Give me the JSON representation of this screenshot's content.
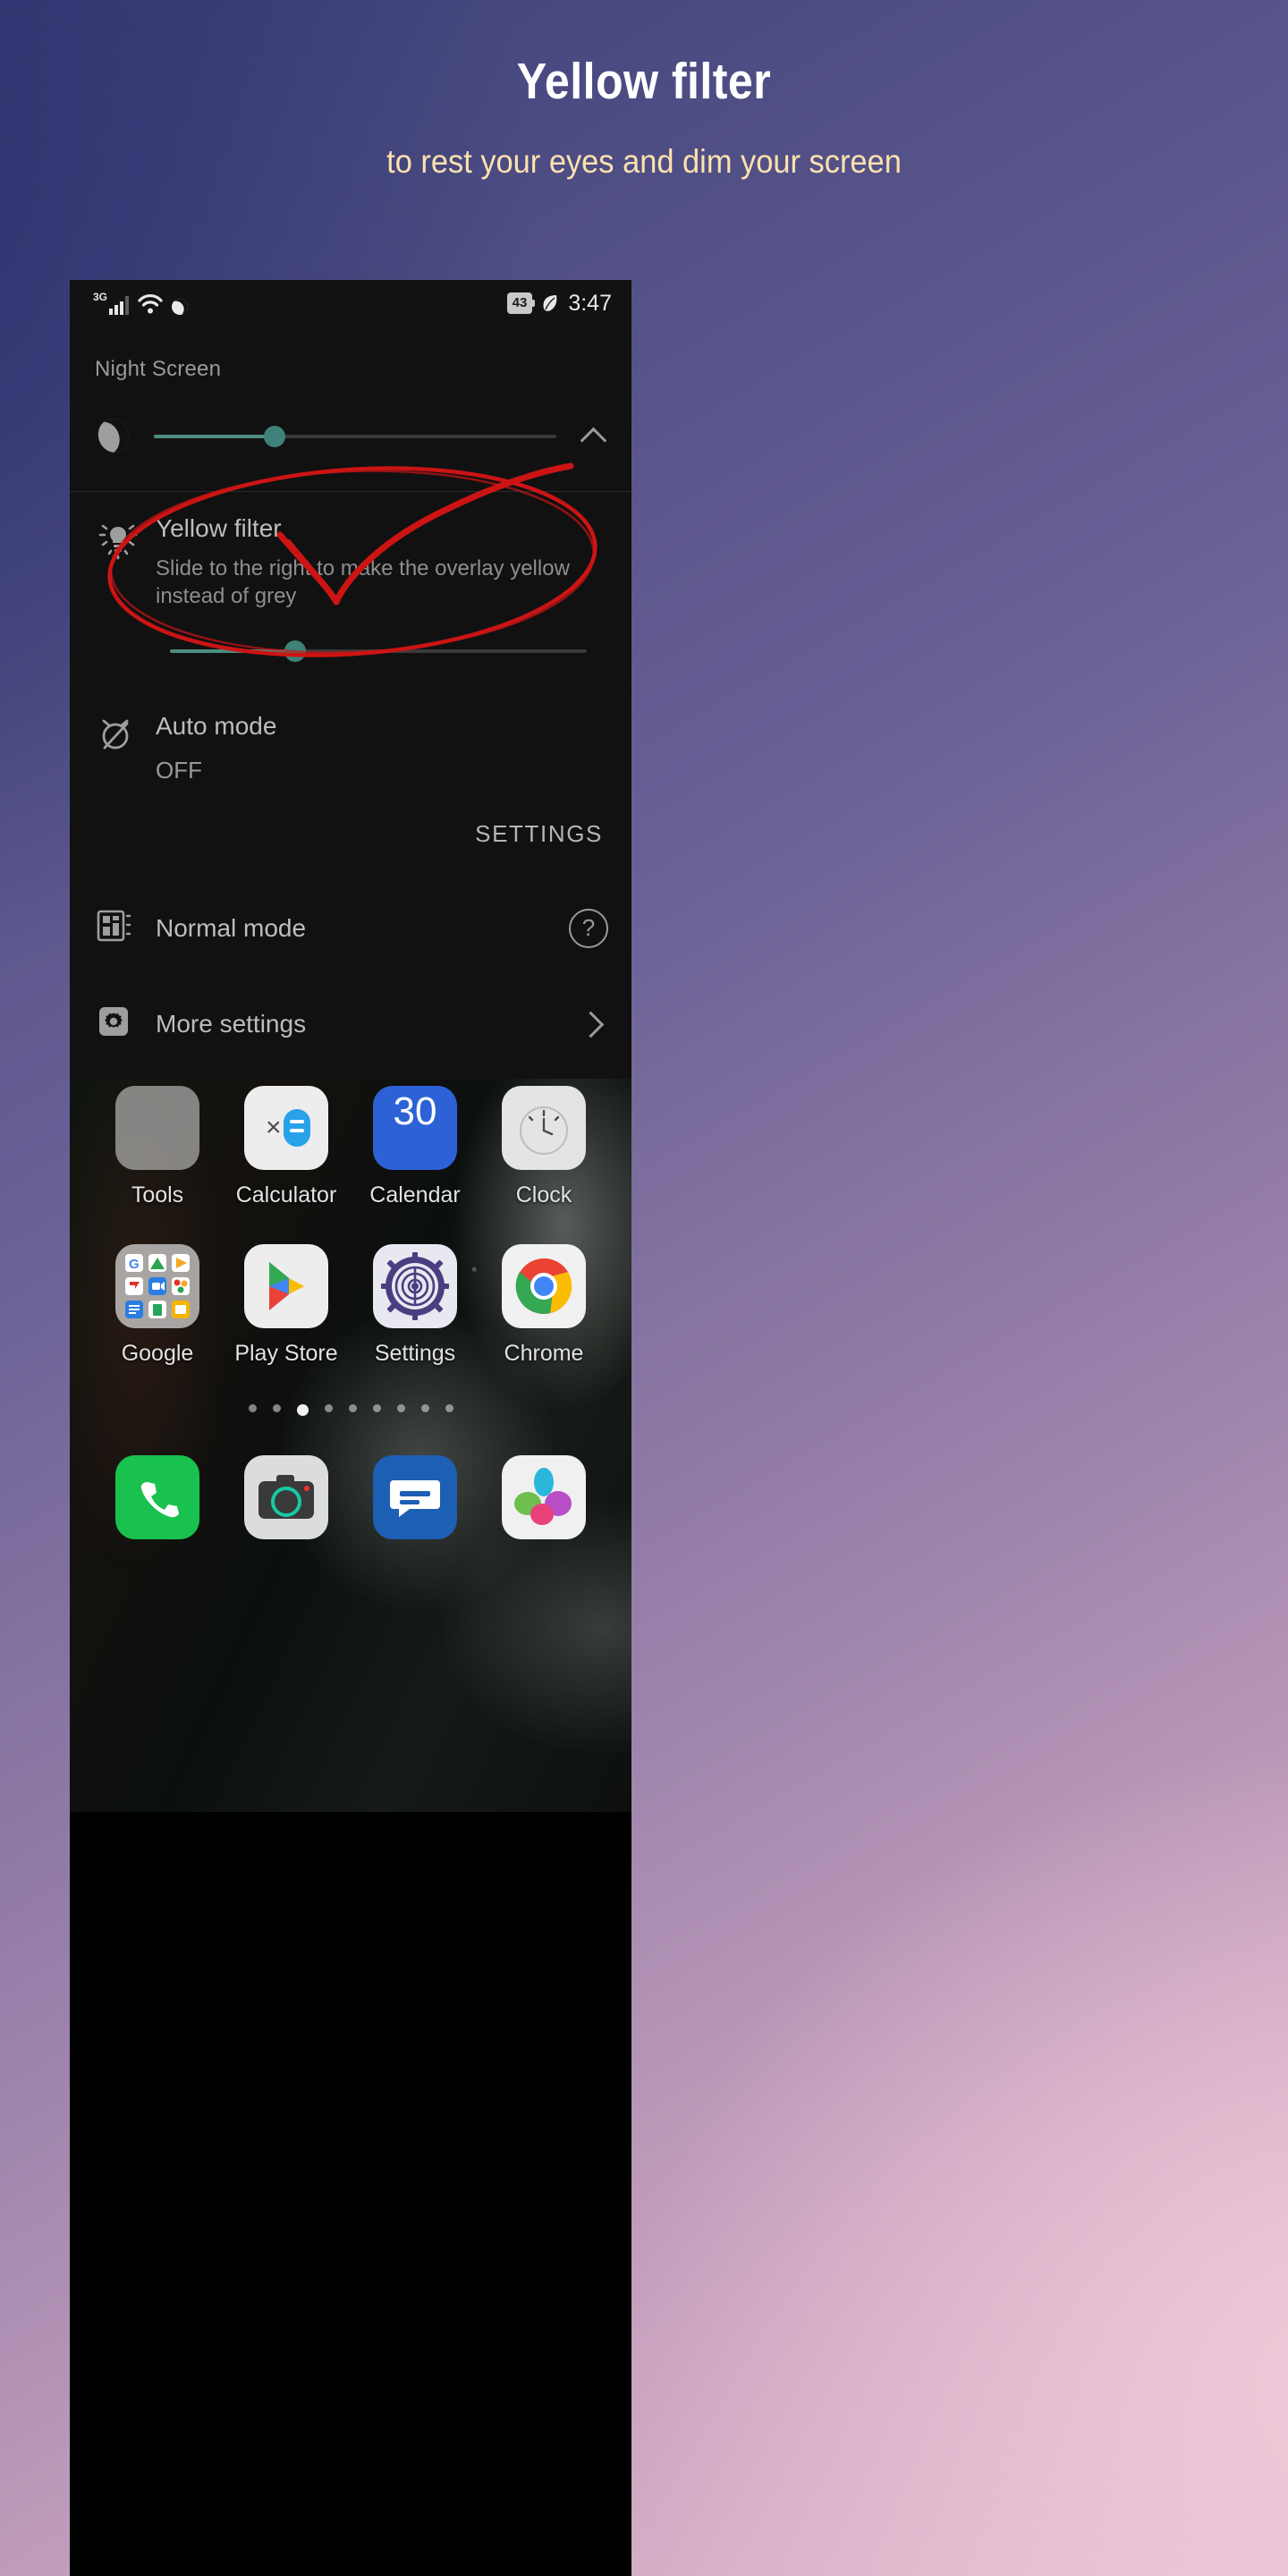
{
  "header": {
    "title": "Yellow filter",
    "subtitle": "to rest your eyes and dim your screen",
    "title_color": "#ffffff",
    "subtitle_color": "#fce1ae"
  },
  "statusbar": {
    "network_type": "3G",
    "signal_icon": "signal-bars-icon",
    "wifi_icon": "wifi-icon",
    "dnd_icon": "moon-icon",
    "battery_level": "43",
    "battery_icon": "battery-icon",
    "stamina_icon": "leaf-icon",
    "time": "3:47"
  },
  "panel": {
    "title": "Night Screen",
    "brightness": {
      "icon": "moon-icon",
      "value_percent": 30,
      "collapse_icon": "chevron-up-icon"
    },
    "yellow_filter": {
      "icon": "lightbulb-icon",
      "title": "Yellow filter",
      "description": "Slide to the right to make the overlay yellow instead of grey",
      "value_percent": 30
    },
    "auto_mode": {
      "icon": "alarm-off-icon",
      "title": "Auto mode",
      "value": "OFF"
    },
    "settings_button": "SETTINGS",
    "normal_mode": {
      "icon": "layout-mode-icon",
      "label": "Normal mode",
      "help_icon": "question-circle-icon"
    },
    "more_settings": {
      "icon": "gear-icon",
      "label": "More settings",
      "chevron_icon": "chevron-right-icon"
    },
    "accent_color": "#3f8279",
    "background_color": "#111111"
  },
  "home": {
    "row1": [
      {
        "name": "Tools",
        "icon": "folder-tools-icon"
      },
      {
        "name": "Calculator",
        "icon": "calculator-icon"
      },
      {
        "name": "Calendar",
        "icon": "calendar-icon",
        "badge": "30"
      },
      {
        "name": "Clock",
        "icon": "clock-icon"
      }
    ],
    "row2": [
      {
        "name": "Google",
        "icon": "google-folder-icon"
      },
      {
        "name": "Play Store",
        "icon": "play-store-icon"
      },
      {
        "name": "Settings",
        "icon": "settings-gear-icon"
      },
      {
        "name": "Chrome",
        "icon": "chrome-icon"
      }
    ],
    "dock": [
      {
        "name": "Phone",
        "icon": "phone-icon"
      },
      {
        "name": "Camera",
        "icon": "camera-icon"
      },
      {
        "name": "Messages",
        "icon": "messages-icon"
      },
      {
        "name": "Album",
        "icon": "album-icon"
      }
    ],
    "page_dots_total": 9,
    "page_dots_active": 3
  },
  "annotation": {
    "shape": "red-ellipse-with-arrow",
    "color": "#cc1414"
  }
}
